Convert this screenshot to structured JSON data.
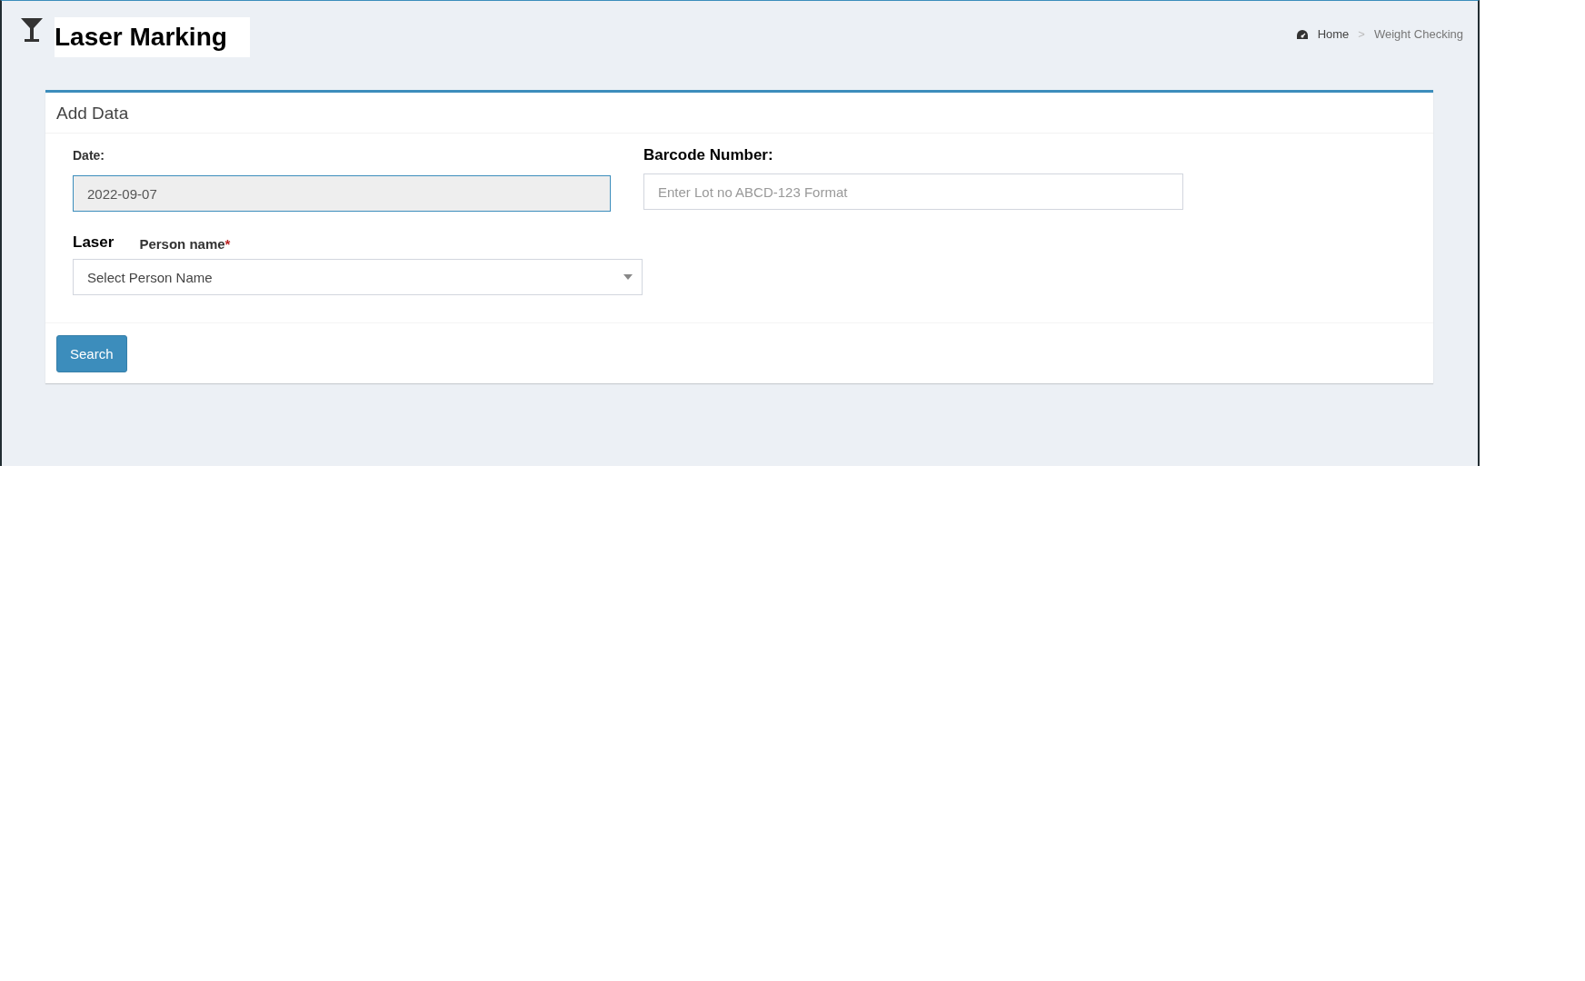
{
  "page_title": "Laser Marking",
  "breadcrumb": [
    {
      "label": "Home",
      "kind": "home"
    },
    {
      "label": "Weight Checking",
      "kind": "current",
      "separator": ">"
    }
  ],
  "card": {
    "title": "Add Data",
    "date": {
      "label": "Date:",
      "value": "2022-09-07"
    },
    "barcode": {
      "label": "Barcode Number:",
      "placeholder": "Enter Lot no ABCD-123 Format"
    },
    "laser_label": "Laser",
    "person": {
      "label": "Person name",
      "required_mark": "*",
      "placeholder": "Select Person Name"
    },
    "button": "Search"
  }
}
